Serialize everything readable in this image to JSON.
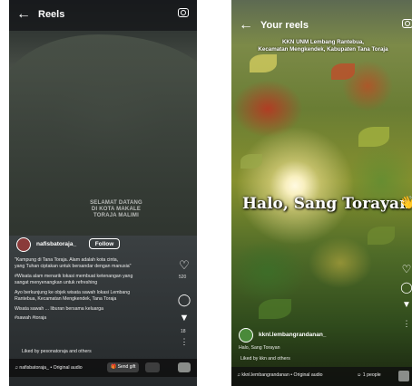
{
  "left_screen": {
    "title": "Reels",
    "back_icon": "arrow-left-icon",
    "camera_icon": "camera-icon",
    "sign_lines": [
      "SELAMAT DATANG",
      "DI KOTA MAKALE",
      "TORAJA MALIMI"
    ],
    "username": "nafisbatoraja_",
    "follow_label": "Follow",
    "caption": [
      "\"Kampung di Tana Toraja. Alam adalah kota cinta,",
      "yang Tuhan ciptakan untuk bersandar dengan manusia\"",
      "#Wisata alam menarik lokasi membuat ketenangan yang",
      "sangat menyenangkan untuk refreshing",
      "Ayo berkunjung ke objek wisata sawah lokasi Lembang",
      "Rantebua, Kecamatan Mengkendek, Tana Toraja",
      "Wisata sawah ... liburan bersama keluarga",
      "#sawah #toraja"
    ],
    "liked_by": "Liked by pesonatoraja and others",
    "like_count": "520",
    "share_count": "18",
    "audio_label": "nafisbatoraja_ • Original audio",
    "send_gift_label": "Send gift"
  },
  "right_screen": {
    "title": "Your reels",
    "overlay_lines": [
      "KKN UNM Lembang Rantebua,",
      "Kecamatan Mengkendek, Kabupaten Tana Toraja"
    ],
    "headline": "Halo, Sang Torayan",
    "wave_emoji": "👋",
    "username": "kknl.lembangrandanan_",
    "caption": "Halo, Sang Torayan",
    "liked_by": "Liked by kkn and others",
    "audio_label": "kknl.lembangrandanan • Original audio",
    "people_label": "1 people"
  },
  "colors": {
    "left_bg": "#15181a",
    "right_bg": "#1a2410",
    "accent_red": "#c8281e"
  }
}
